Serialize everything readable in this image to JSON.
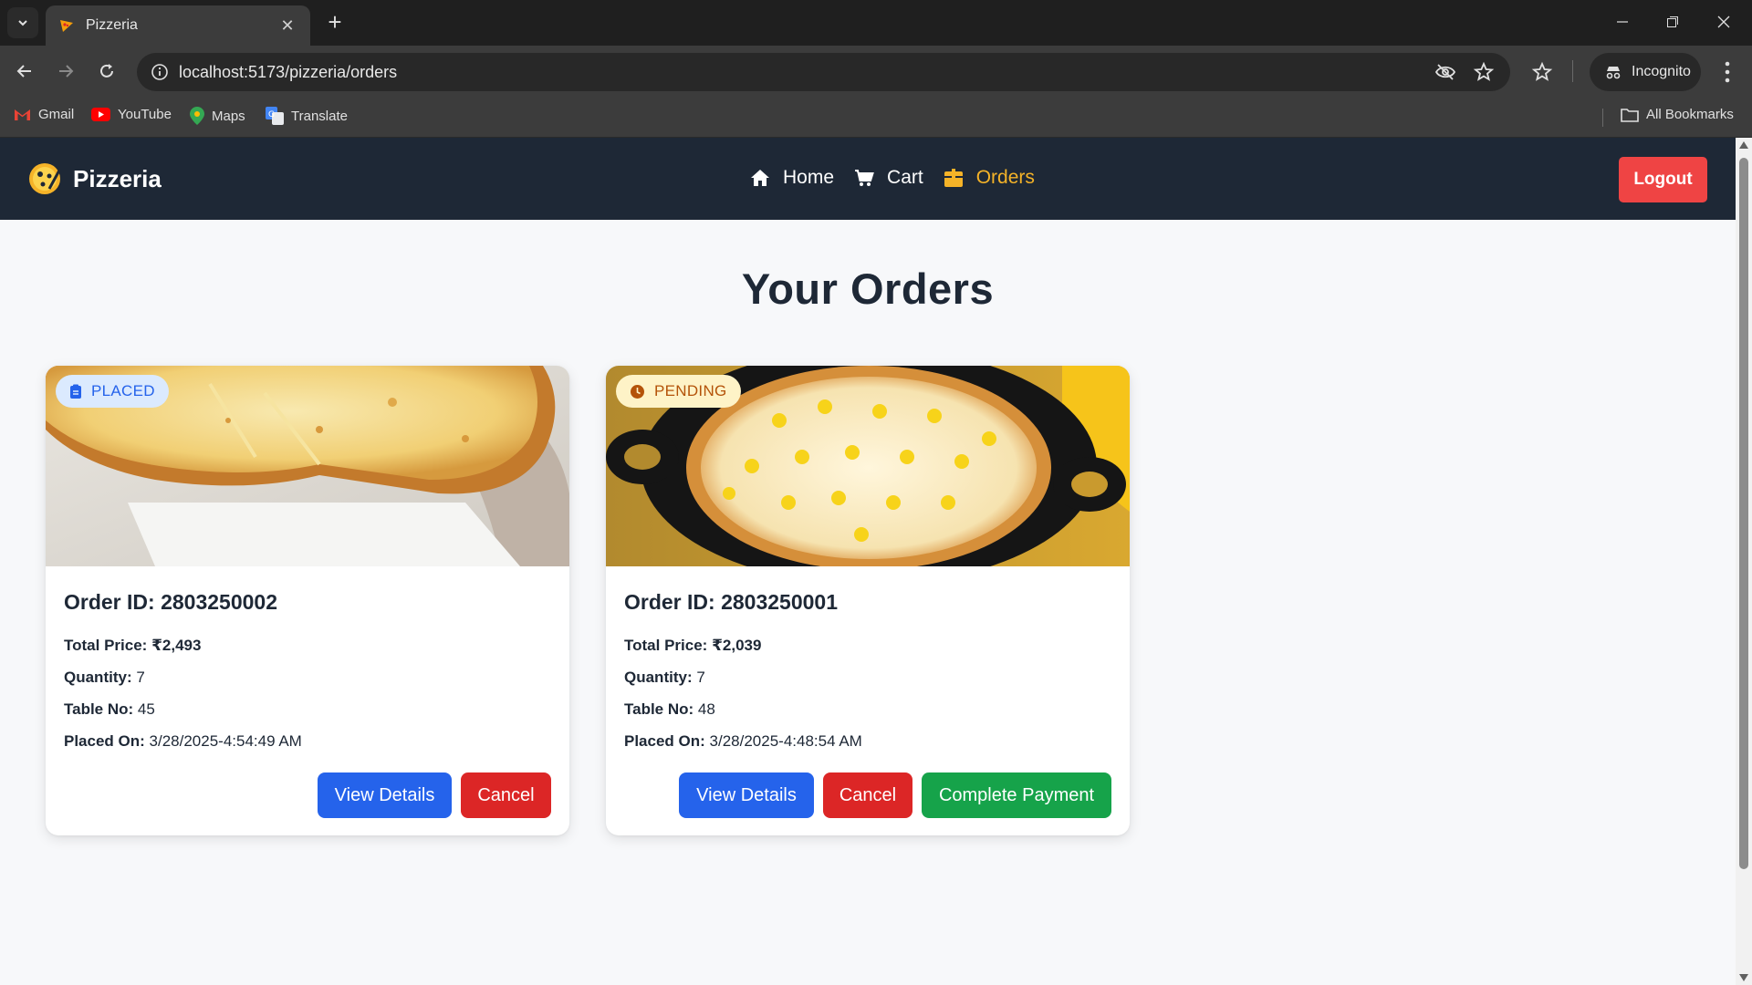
{
  "browser": {
    "tab_title": "Pizzeria",
    "url": "localhost:5173/pizzeria/orders",
    "incognito_label": "Incognito",
    "bookmarks": [
      "Gmail",
      "YouTube",
      "Maps",
      "Translate"
    ],
    "all_bookmarks_label": "All Bookmarks"
  },
  "navbar": {
    "brand": "Pizzeria",
    "menu": [
      {
        "label": "Home",
        "icon": "home-icon"
      },
      {
        "label": "Cart",
        "icon": "cart-icon"
      },
      {
        "label": "Orders",
        "icon": "box-icon",
        "active": true
      }
    ],
    "logout_label": "Logout"
  },
  "page_title": "Your Orders",
  "orders": [
    {
      "status": "PLACED",
      "status_icon": "clipboard-icon",
      "order_id_label": "Order ID: 2803250002",
      "total_price_label": "Total Price:",
      "total_price": "₹2,493",
      "quantity_label": "Quantity:",
      "quantity": "7",
      "table_label": "Table No:",
      "table": "45",
      "placed_label": "Placed On:",
      "placed_on": "3/28/2025-4:54:49 AM",
      "buttons": [
        "View Details",
        "Cancel"
      ]
    },
    {
      "status": "PENDING",
      "status_icon": "clock-icon",
      "order_id_label": "Order ID: 2803250001",
      "total_price_label": "Total Price:",
      "total_price": "₹2,039",
      "quantity_label": "Quantity:",
      "quantity": "7",
      "table_label": "Table No:",
      "table": "48",
      "placed_label": "Placed On:",
      "placed_on": "3/28/2025-4:48:54 AM",
      "buttons": [
        "View Details",
        "Cancel",
        "Complete Payment"
      ]
    }
  ],
  "colors": {
    "navbar_bg": "#1e2836",
    "active_menu": "#f5b328",
    "logout": "#ef4444",
    "btn_view": "#2563eb",
    "btn_cancel": "#dc2626",
    "btn_pay": "#16a34a"
  }
}
